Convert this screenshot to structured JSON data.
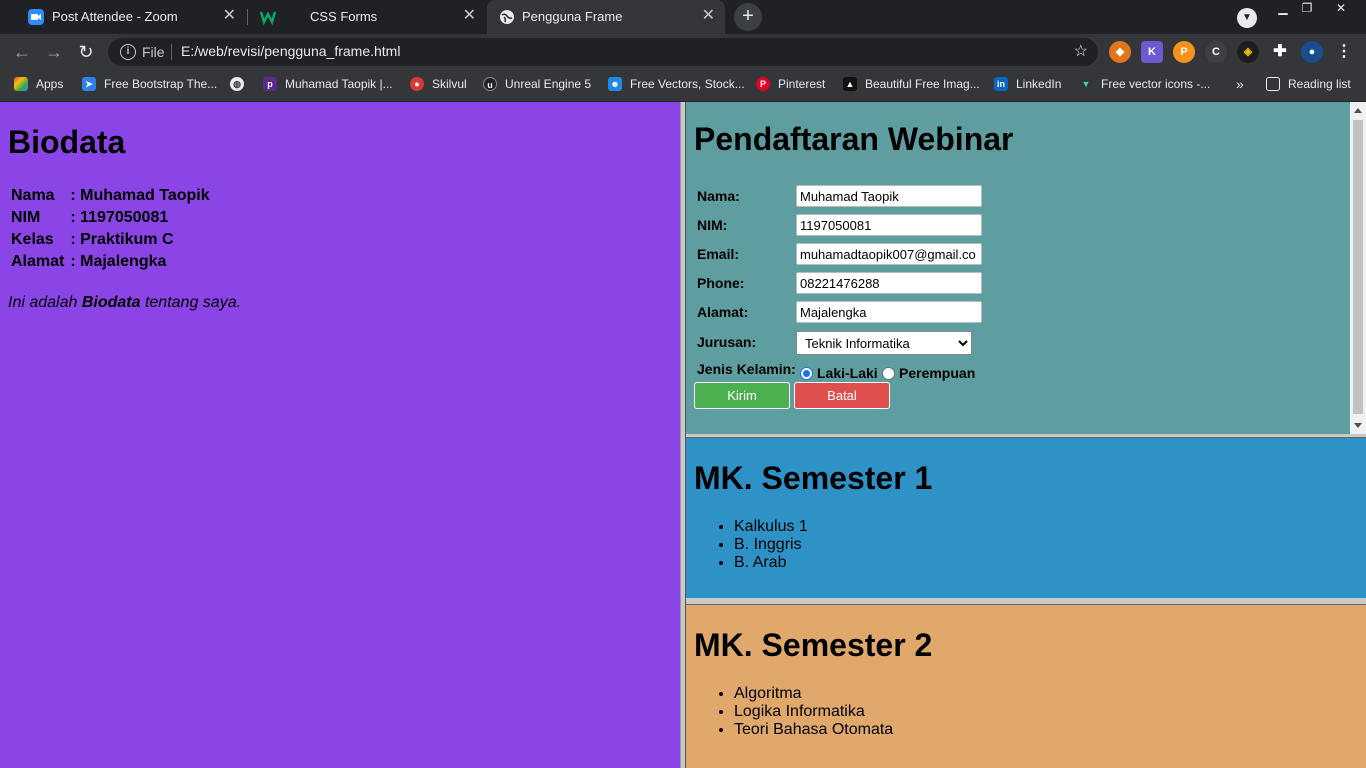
{
  "browser": {
    "tabs": [
      {
        "title": "Post Attendee - Zoom",
        "icon": "zoom-icon"
      },
      {
        "title": "CSS Forms",
        "icon": "w3schools-icon"
      },
      {
        "title": "Pengguna Frame",
        "icon": "globe-icon"
      }
    ],
    "address": {
      "scheme_label": "File",
      "url": "E:/web/revisi/pengguna_frame.html"
    },
    "bookmarks": [
      "Apps",
      "Free Bootstrap The...",
      "",
      "Muhamad Taopik |...",
      "Skilvul",
      "Unreal Engine 5",
      "Free Vectors, Stock...",
      "Pinterest",
      "Beautiful Free Imag...",
      "LinkedIn",
      "Free vector icons -...",
      "»",
      "Reading list"
    ],
    "extensions": [
      "metamask-icon",
      "k-icon",
      "coin-icon",
      "c-icon",
      "binance-icon",
      "puzzle-icon",
      "profile-icon"
    ]
  },
  "left_frame": {
    "title": "Biodata",
    "rows": [
      {
        "label": "Nama",
        "value": ": Muhamad Taopik"
      },
      {
        "label": "NIM",
        "value": ": 1197050081"
      },
      {
        "label": "Kelas",
        "value": ": Praktikum C"
      },
      {
        "label": "Alamat",
        "value": ": Majalengka"
      }
    ],
    "note_pre": "Ini adalah ",
    "note_bold": "Biodata",
    "note_post": " tentang saya."
  },
  "form": {
    "title": "Pendaftaran Webinar",
    "fields": [
      {
        "label": "Nama:",
        "value": "Muhamad Taopik"
      },
      {
        "label": "NIM:",
        "value": "1197050081"
      },
      {
        "label": "Email:",
        "value": "muhamadtaopik007@gmail.co"
      },
      {
        "label": "Phone:",
        "value": "08221476288"
      },
      {
        "label": "Alamat:",
        "value": "Majalengka"
      }
    ],
    "jurusan_label": "Jurusan:",
    "jurusan_value": "Teknik Informatika",
    "gender_label": "Jenis Kelamin:",
    "gender_options": [
      "Laki-Laki",
      "Perempuan"
    ],
    "gender_selected": "Laki-Laki",
    "submit_label": "Kirim",
    "cancel_label": "Batal",
    "colors": {
      "submit": "#4caf50",
      "cancel": "#e04e4e",
      "bg": "#5f9ea0"
    }
  },
  "semester1": {
    "title": "MK. Semester 1",
    "items": [
      "Kalkulus 1",
      "B. Inggris",
      "B. Arab"
    ]
  },
  "semester2": {
    "title": "MK. Semester 2",
    "items": [
      "Algoritma",
      "Logika Informatika",
      "Teori Bahasa Otomata"
    ]
  }
}
